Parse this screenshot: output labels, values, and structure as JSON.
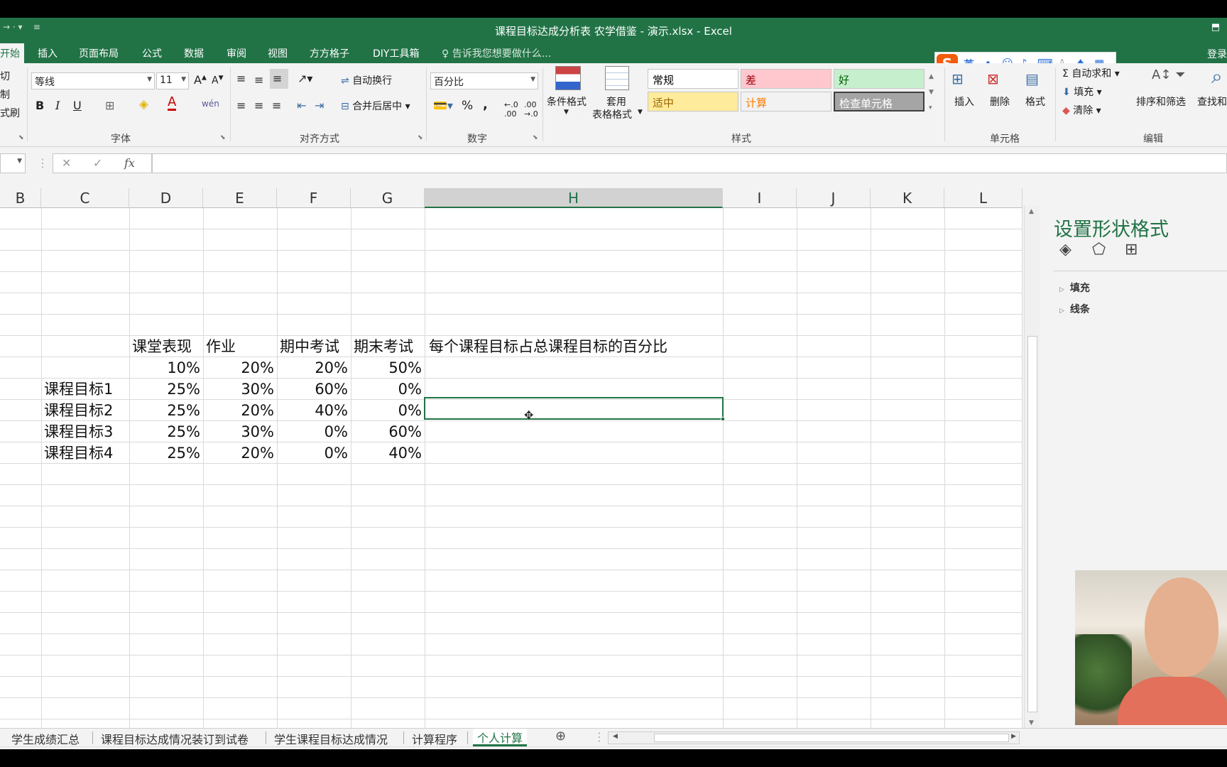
{
  "window": {
    "title": "课程目标达成分析表 农学借鉴 - 演示.xlsx - Excel"
  },
  "menu_tabs": [
    {
      "label": "开始",
      "active": true
    },
    {
      "label": "插入"
    },
    {
      "label": "页面布局"
    },
    {
      "label": "公式"
    },
    {
      "label": "数据"
    },
    {
      "label": "审阅"
    },
    {
      "label": "视图"
    },
    {
      "label": "方方格子"
    },
    {
      "label": "DIY工具箱"
    }
  ],
  "tell_me": "告诉我您想要做什么...",
  "login": "登录",
  "ime": {
    "logo": "S",
    "mode": "英"
  },
  "ribbon": {
    "clipboard": {
      "cut": "切",
      "copy": "制",
      "format_painter": "式刷"
    },
    "font": {
      "name": "等线",
      "size": "11",
      "bold": "B",
      "italic": "I",
      "underline": "U",
      "group": "字体",
      "wen": "wén"
    },
    "alignment": {
      "wrap": "自动换行",
      "merge": "合并后居中",
      "group": "对齐方式"
    },
    "number": {
      "format": "百分比",
      "percent": "%",
      "comma": ",",
      "group": "数字"
    },
    "styles": {
      "conditional": "条件格式",
      "table1": "套用",
      "table2": "表格格式",
      "group": "样式",
      "items": [
        {
          "label": "常规",
          "bg": "#ffffff",
          "fg": "#000000"
        },
        {
          "label": "差",
          "bg": "#ffc7ce",
          "fg": "#9c0006"
        },
        {
          "label": "好",
          "bg": "#c6efce",
          "fg": "#006100"
        },
        {
          "label": "适中",
          "bg": "#ffeb9c",
          "fg": "#9c6500"
        },
        {
          "label": "计算",
          "bg": "#f2f2f2",
          "fg": "#fa7d00"
        },
        {
          "label": "检查单元格",
          "bg": "#a5a5a5",
          "fg": "#ffffff"
        }
      ]
    },
    "cells": {
      "insert": "插入",
      "delete": "删除",
      "format": "格式",
      "group": "单元格"
    },
    "editing": {
      "autosum": "自动求和",
      "fill": "填充",
      "clear": "清除",
      "sort": "排序和筛选",
      "find": "查找和",
      "group": "编辑"
    }
  },
  "formula_bar": {
    "fx": "fx",
    "value": ""
  },
  "columns": [
    "B",
    "C",
    "D",
    "E",
    "F",
    "G",
    "H",
    "I",
    "J",
    "K",
    "L"
  ],
  "selected_column": "H",
  "table": {
    "header": [
      "课堂表现",
      "作业",
      "期中考试",
      "期末考试",
      "每个课程目标占总课程目标的百分比"
    ],
    "weights": [
      "10%",
      "20%",
      "20%",
      "50%"
    ],
    "rows": [
      {
        "label": "课程目标1",
        "values": [
          "25%",
          "30%",
          "60%",
          "0%"
        ]
      },
      {
        "label": "课程目标2",
        "values": [
          "25%",
          "20%",
          "40%",
          "0%"
        ]
      },
      {
        "label": "课程目标3",
        "values": [
          "25%",
          "30%",
          "0%",
          "60%"
        ]
      },
      {
        "label": "课程目标4",
        "values": [
          "25%",
          "20%",
          "0%",
          "40%"
        ]
      }
    ]
  },
  "format_pane": {
    "title": "设置形状格式",
    "sections": [
      "填充",
      "线条"
    ]
  },
  "sheet_tabs": [
    {
      "label": "学生成绩汇总"
    },
    {
      "label": "课程目标达成情况装订到试卷"
    },
    {
      "label": "学生课程目标达成情况"
    },
    {
      "label": "计算程序"
    },
    {
      "label": "个人计算",
      "active": true
    }
  ]
}
